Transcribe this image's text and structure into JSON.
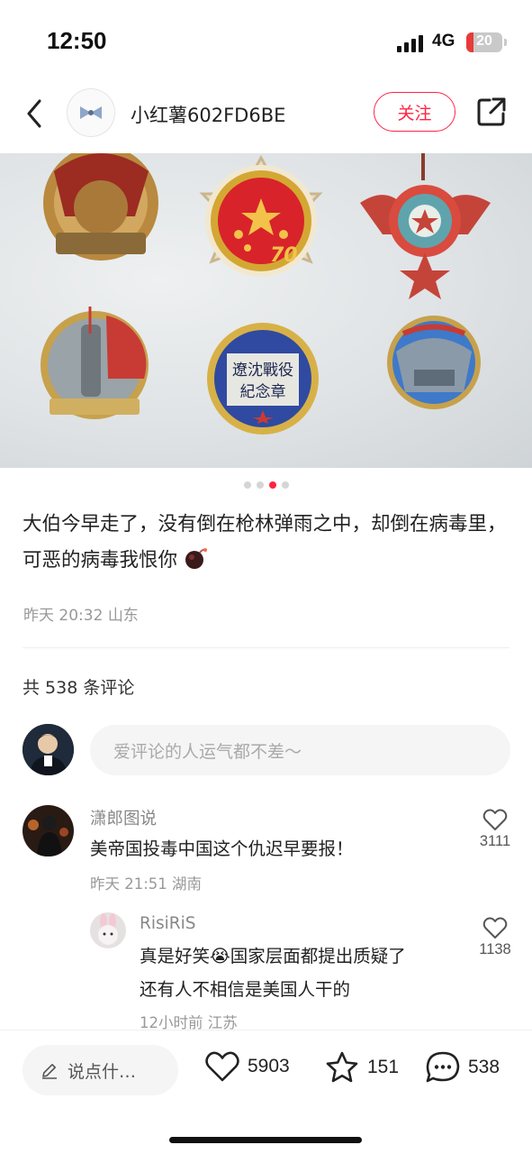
{
  "status_bar": {
    "time": "12:50",
    "network": "4G",
    "battery": "20"
  },
  "nav": {
    "author_name": "小红薯602FD6BE",
    "follow_label": "关注",
    "icons": [
      "back-icon",
      "share-icon"
    ]
  },
  "carousel": {
    "count": 4,
    "active_index": 2
  },
  "post": {
    "text": "大伯今早走了，没有倒在枪林弹雨之中，却倒在病毒里，可恶的病毒我恨你",
    "time": "昨天 20:32",
    "location": "山东"
  },
  "medals": {
    "text": [
      "遼沈戰役",
      "紀念章"
    ]
  },
  "comments_header": {
    "count_label": "共 538 条评论"
  },
  "comment_input": {
    "placeholder": "爱评论的人运气都不差～"
  },
  "comments": [
    {
      "name": "潇郎图说",
      "text": "美帝国投毒中国这个仇迟早要报！",
      "time": "昨天 21:51",
      "location": "湖南",
      "likes": "3111"
    },
    {
      "name": "RisiRiS",
      "text_line1": "真是好笑😭国家层面都提出质疑了",
      "text_line2": "还有人不相信是美国人干的",
      "time": "12小时前",
      "location": "江苏",
      "likes": "1138"
    }
  ],
  "bottom_bar": {
    "say_placeholder": "说点什…",
    "likes": "5903",
    "favorites": "151",
    "comments": "538"
  },
  "colors": {
    "accent": "#ff2442"
  }
}
